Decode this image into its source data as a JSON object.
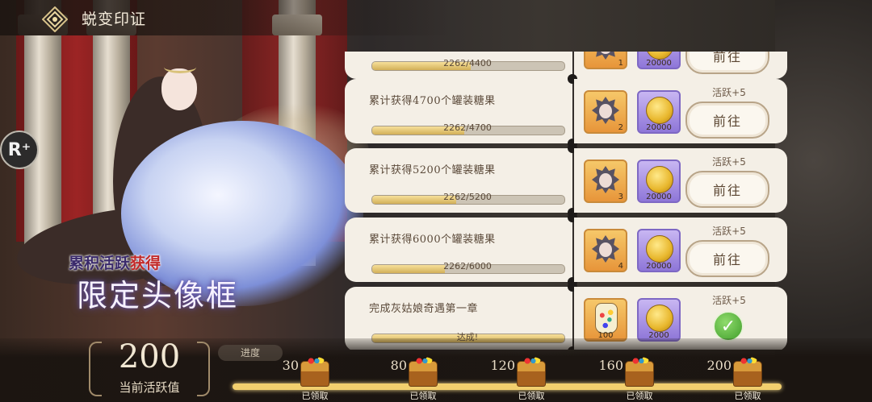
{
  "header": {
    "title": "蜕变印证",
    "icon": "diamond-emblem-icon"
  },
  "side_button": {
    "label": "R⁺",
    "icon": "r-plus-icon"
  },
  "promo": {
    "line1_prefix": "累积活跃",
    "line1_highlight": "获得",
    "line2": "限定头像框"
  },
  "tasks": [
    {
      "name": "",
      "progress_text": "2262/4400",
      "progress": 0.514,
      "frame_count": "1",
      "coin_count": "20000",
      "activity": "",
      "action": "前往",
      "status": "go"
    },
    {
      "name": "累计获得4700个罐装糖果",
      "progress_text": "2262/4700",
      "progress": 0.481,
      "frame_count": "2",
      "coin_count": "20000",
      "activity": "活跃+5",
      "action": "前往",
      "status": "go"
    },
    {
      "name": "累计获得5200个罐装糖果",
      "progress_text": "2262/5200",
      "progress": 0.435,
      "frame_count": "3",
      "coin_count": "20000",
      "activity": "活跃+5",
      "action": "前往",
      "status": "go"
    },
    {
      "name": "累计获得6000个罐装糖果",
      "progress_text": "2262/6000",
      "progress": 0.377,
      "frame_count": "4",
      "coin_count": "20000",
      "activity": "活跃+5",
      "action": "前往",
      "status": "go"
    },
    {
      "name": "完成灰姑娘奇遇第一章",
      "progress_text": "达成!",
      "progress": 1.0,
      "jar_count": "100",
      "coin_count": "2000",
      "activity": "活跃+5",
      "action": "",
      "status": "done"
    }
  ],
  "summary": {
    "total_activity": "200",
    "total_label": "当前活跃值",
    "progress_tag": "进度"
  },
  "milestones": [
    {
      "value": "30",
      "state": "已领取"
    },
    {
      "value": "80",
      "state": "已领取"
    },
    {
      "value": "120",
      "state": "已领取"
    },
    {
      "value": "160",
      "state": "已领取"
    },
    {
      "value": "200",
      "state": "已领取"
    }
  ],
  "milestone_progress": 1.0
}
